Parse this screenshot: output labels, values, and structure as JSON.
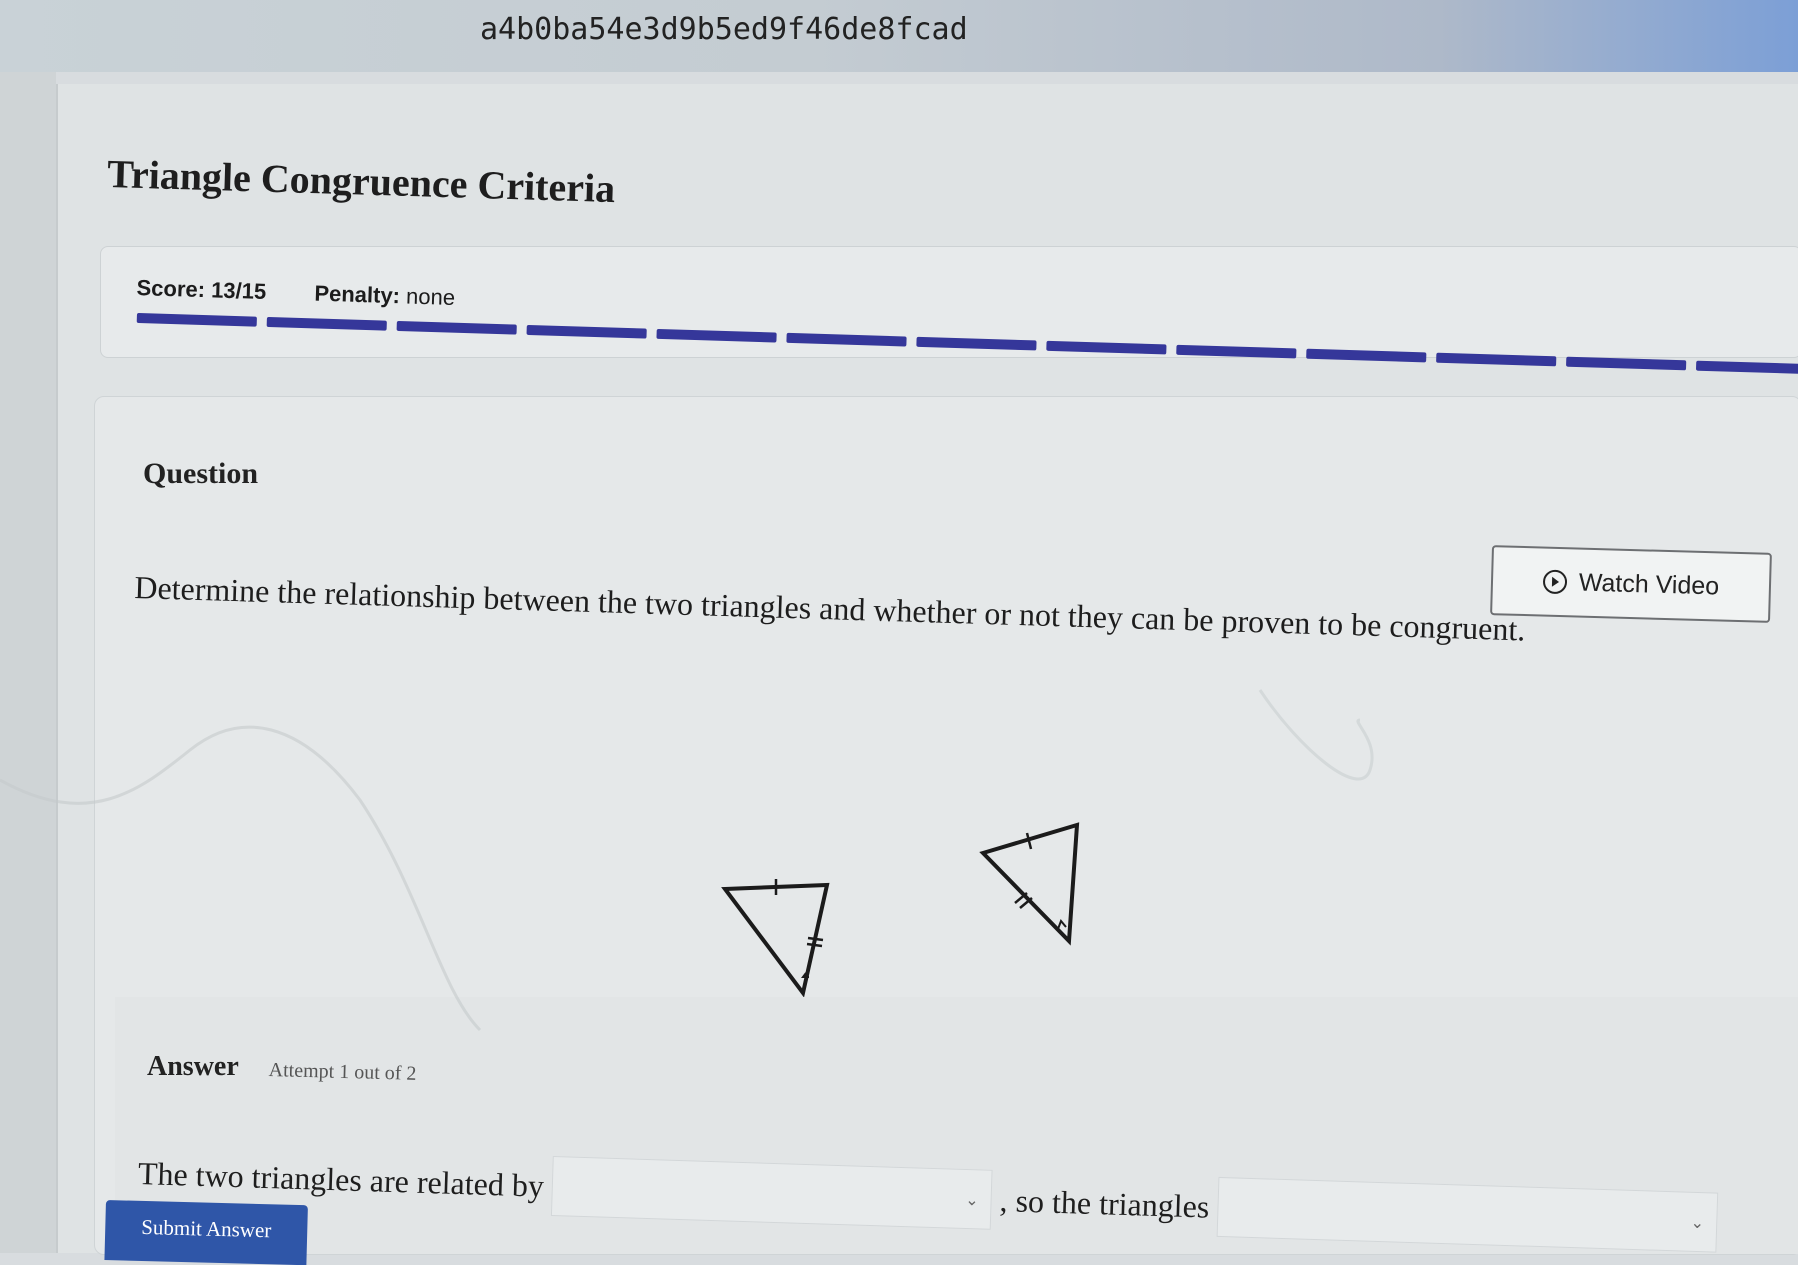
{
  "browser": {
    "url_fragment": "a4b0ba54e3d9b5ed9f46de8fcad"
  },
  "page": {
    "title": "Triangle Congruence Criteria"
  },
  "score_bar": {
    "score_label": "Score:",
    "score_value": "13/15",
    "penalty_label": "Penalty:",
    "penalty_value": "none",
    "progress_segments": 13,
    "progress_color": "#35379a"
  },
  "question": {
    "heading": "Question",
    "watch_video_label": "Watch Video",
    "watch_video_icon": "play-circle-icon",
    "text": "Determine the relationship between the two triangles and whether or not they can be proven to be congruent."
  },
  "answer": {
    "heading": "Answer",
    "attempt_text": "Attempt 1 out of 2",
    "sentence_part1": "The two triangles are related by",
    "select1_value": "",
    "sentence_part2": ", so the triangles",
    "select2_value": "",
    "dropdown_icon": "chevron-down-icon",
    "submit_label": "Submit Answer",
    "submit_color": "#2f56a8"
  }
}
